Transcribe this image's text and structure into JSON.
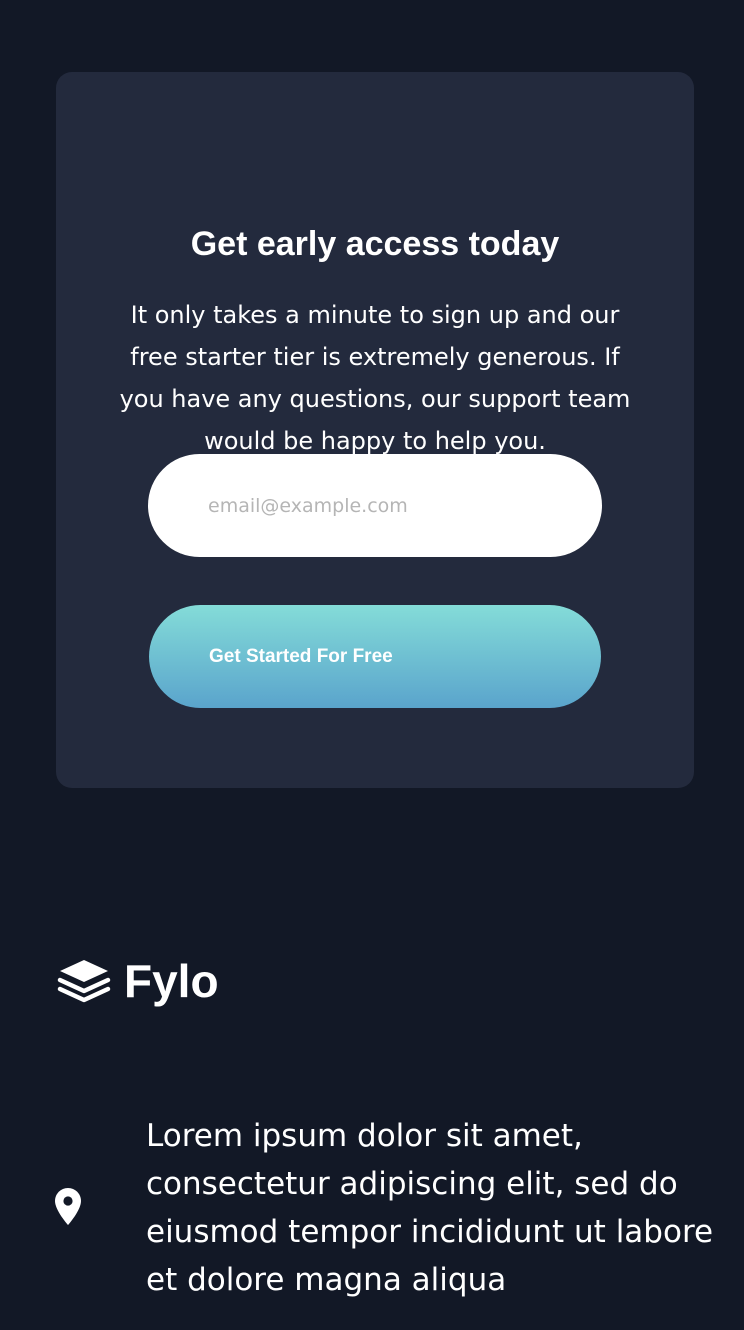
{
  "signup": {
    "title": "Get early access today",
    "description": "It only takes a minute to sign up and our free starter tier is extremely generous. If you have any questions, our support team would be happy to help you.",
    "email_placeholder": "email@example.com",
    "email_value": "",
    "button_label": "Get Started For Free"
  },
  "footer": {
    "logo_text": "Fylo",
    "logo_icon": "stacked-layers-icon",
    "address_icon": "location-pin-icon",
    "address": "Lorem ipsum dolor sit amet, consectetur adipiscing elit, sed do eiusmod tempor incididunt ut labore et dolore magna aliqua"
  },
  "colors": {
    "page_background": "#121826",
    "card_background": "#232a3d",
    "button_gradient_start": "#84dcd8",
    "button_gradient_end": "#5aa4cc",
    "text": "#ffffff"
  }
}
